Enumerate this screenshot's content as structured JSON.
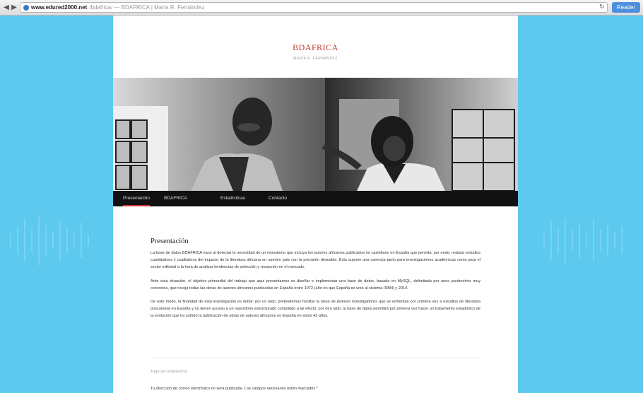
{
  "browser": {
    "url_domain": "www.edured2000.net",
    "url_rest": "/bdafrica/ — BDAFRICA | María R. Fernández",
    "reader_label": "Reader"
  },
  "site": {
    "title": "BDAFRICA",
    "subtitle": "MARÍA R. FERNÁNDEZ"
  },
  "nav": {
    "items": [
      {
        "label": "Presentación"
      },
      {
        "label": "BDAFRICA"
      },
      {
        "label": "Estadísticas"
      },
      {
        "label": "Contacto"
      }
    ]
  },
  "main": {
    "heading": "Presentación",
    "paragraphs": [
      "La base de datos BDAFRICA nace al detectar la necesidad de un repositorio que incluya los autores africanos publicados en castellano en España que permita, por ende, realizar estudios cuantitativos y cualitativos del impacto de la literatura africana en nuestro país con la precisión deseable. Esto supone una carencia tanto para investigaciones académicas como para el sector editorial a la hora de analizar tendencias de selección y recepción en el mercado.",
      "Ante esta situación, el objetivo primordial del trabajo que aquí presentamos es diseñar e implementar una base de datos, basada en MySQL, delimitada por unos parámetros muy concretos, que recoja todas las obras de autores africanos publicadas en España entre 1972 (año en que España se unió al sistema ISBN) y 2014.",
      "De este modo, la finalidad de esta investigación es doble: por un lado, pretendemos facilitar la tarea de jóvenes investigadores que se enfrentan por primera vez a estudios de literatura poscolonial en España y no tienen acceso a un repositorio estructurado compilado a tal efecto; por otro lado, la base de datos permitirá por primera vez hacer un tratamiento estadístico de la evolución que ha sufrido la publicación de obras de autores africanos en España en estos 42 años."
    ]
  },
  "comments": {
    "title": "Deja un comentario",
    "note": "Tu dirección de correo electrónico no será publicada. Los campos necesarios están marcados *"
  }
}
